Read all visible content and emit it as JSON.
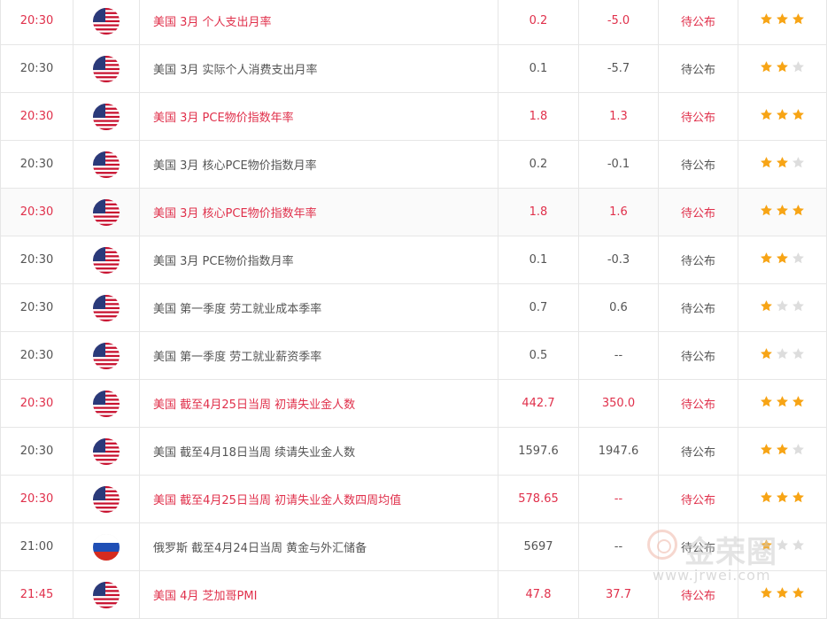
{
  "colors": {
    "important_text": "#e0304b",
    "normal_text": "#555555",
    "star_on": "#f7a415",
    "star_off": "#dddddd"
  },
  "rows": [
    {
      "time": "20:30",
      "country": "us",
      "event": "美国 3月 个人支出月率",
      "previous": "0.2",
      "consensus": "-5.0",
      "actual": "待公布",
      "stars": 3
    },
    {
      "time": "20:30",
      "country": "us",
      "event": "美国 3月 实际个人消费支出月率",
      "previous": "0.1",
      "consensus": "-5.7",
      "actual": "待公布",
      "stars": 2
    },
    {
      "time": "20:30",
      "country": "us",
      "event": "美国 3月 PCE物价指数年率",
      "previous": "1.8",
      "consensus": "1.3",
      "actual": "待公布",
      "stars": 3
    },
    {
      "time": "20:30",
      "country": "us",
      "event": "美国 3月 核心PCE物价指数月率",
      "previous": "0.2",
      "consensus": "-0.1",
      "actual": "待公布",
      "stars": 2
    },
    {
      "time": "20:30",
      "country": "us",
      "event": "美国 3月 核心PCE物价指数年率",
      "previous": "1.8",
      "consensus": "1.6",
      "actual": "待公布",
      "stars": 3
    },
    {
      "time": "20:30",
      "country": "us",
      "event": "美国 3月 PCE物价指数月率",
      "previous": "0.1",
      "consensus": "-0.3",
      "actual": "待公布",
      "stars": 2
    },
    {
      "time": "20:30",
      "country": "us",
      "event": "美国 第一季度 劳工就业成本季率",
      "previous": "0.7",
      "consensus": "0.6",
      "actual": "待公布",
      "stars": 1
    },
    {
      "time": "20:30",
      "country": "us",
      "event": "美国 第一季度 劳工就业薪资季率",
      "previous": "0.5",
      "consensus": "--",
      "actual": "待公布",
      "stars": 1
    },
    {
      "time": "20:30",
      "country": "us",
      "event": "美国 截至4月25日当周 初请失业金人数",
      "previous": "442.7",
      "consensus": "350.0",
      "actual": "待公布",
      "stars": 3
    },
    {
      "time": "20:30",
      "country": "us",
      "event": "美国 截至4月18日当周 续请失业金人数",
      "previous": "1597.6",
      "consensus": "1947.6",
      "actual": "待公布",
      "stars": 2
    },
    {
      "time": "20:30",
      "country": "us",
      "event": "美国 截至4月25日当周 初请失业金人数四周均值",
      "previous": "578.65",
      "consensus": "--",
      "actual": "待公布",
      "stars": 3
    },
    {
      "time": "21:00",
      "country": "ru",
      "event": "俄罗斯 截至4月24日当周 黄金与外汇储备",
      "previous": "5697",
      "consensus": "--",
      "actual": "待公布",
      "stars": 1
    },
    {
      "time": "21:45",
      "country": "us",
      "event": "美国 4月 芝加哥PMI",
      "previous": "47.8",
      "consensus": "37.7",
      "actual": "待公布",
      "stars": 3
    }
  ],
  "watermark": {
    "name": "金荣圈",
    "url": "www.jrwei.com"
  }
}
